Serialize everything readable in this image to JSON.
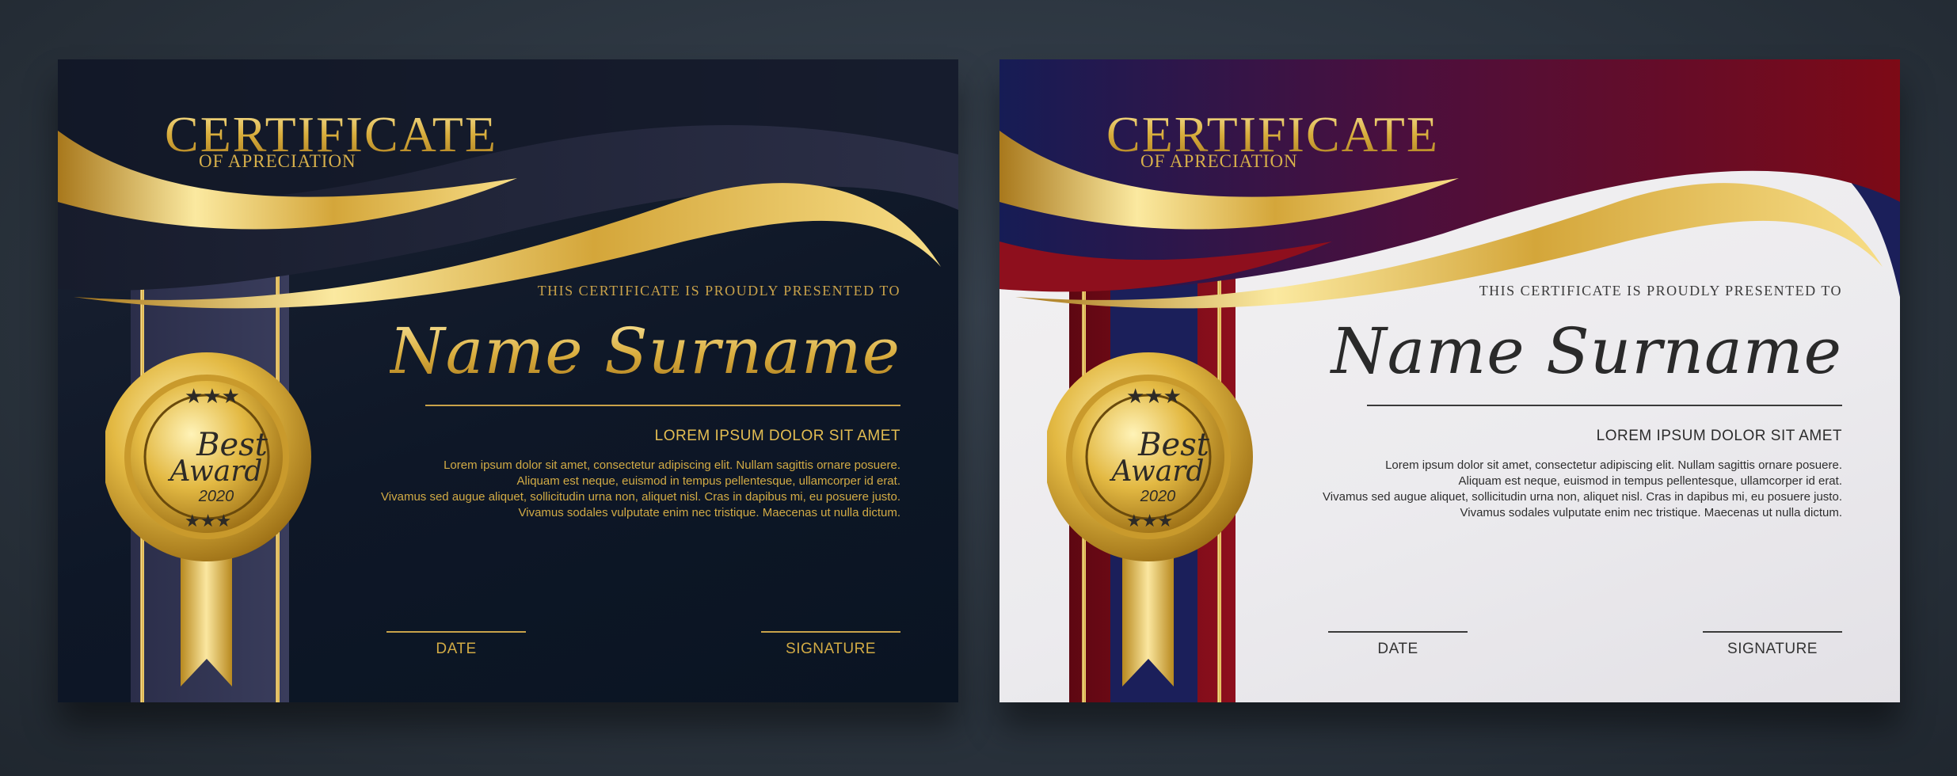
{
  "certificates": [
    {
      "theme": "dark",
      "title": "CERTIFICATE",
      "subtitle": "OF APRECIATION",
      "presented_to": "THIS CERTIFICATE IS PROUDLY PRESENTED TO",
      "name": "Name Surname",
      "lorem_title": "LOREM IPSUM DOLOR SIT AMET",
      "body_lines": [
        "Lorem ipsum dolor sit amet, consectetur adipiscing elit. Nullam sagittis ornare posuere.",
        "Aliquam est neque, euismod in tempus pellentesque, ullamcorper id erat.",
        "Vivamus sed augue aliquet, sollicitudin urna non, aliquet nisl. Cras in dapibus mi, eu posuere justo.",
        "Vivamus sodales vulputate enim nec tristique. Maecenas ut nulla dictum."
      ],
      "date_label": "DATE",
      "signature_label": "SIGNATURE",
      "seal": {
        "line1": "Best",
        "line2": "Award",
        "year": "2020"
      },
      "colors": {
        "background": "#0e1727",
        "gold": "#d9b44a",
        "band": "#2b2e4a"
      }
    },
    {
      "theme": "light",
      "title": "CERTIFICATE",
      "subtitle": "OF APRECIATION",
      "presented_to": "THIS CERTIFICATE IS PROUDLY PRESENTED TO",
      "name": "Name Surname",
      "lorem_title": "LOREM IPSUM DOLOR SIT AMET",
      "body_lines": [
        "Lorem ipsum dolor sit amet, consectetur adipiscing elit. Nullam sagittis ornare posuere.",
        "Aliquam est neque, euismod in tempus pellentesque, ullamcorper id erat.",
        "Vivamus sed augue aliquet, sollicitudin urna non, aliquet nisl. Cras in dapibus mi, eu posuere justo.",
        "Vivamus sodales vulputate enim nec tristique. Maecenas ut nulla dictum."
      ],
      "date_label": "DATE",
      "signature_label": "SIGNATURE",
      "seal": {
        "line1": "Best",
        "line2": "Award",
        "year": "2020"
      },
      "colors": {
        "background": "#efedf0",
        "gold": "#d9b44a",
        "red": "#7a0a18",
        "navy": "#1b1f5a"
      }
    }
  ]
}
